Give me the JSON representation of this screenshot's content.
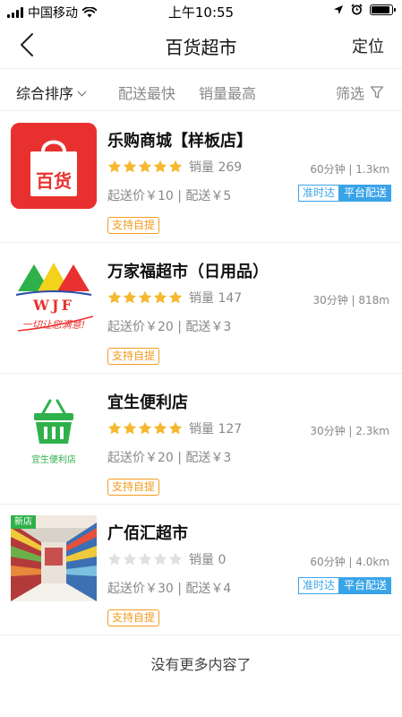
{
  "status_bar": {
    "carrier": "中国移动",
    "time": "上午10:55",
    "battery_level": 0.9
  },
  "nav": {
    "title": "百货超市",
    "right_label": "定位"
  },
  "sort_bar": {
    "items": [
      {
        "label": "综合排序",
        "active": true
      },
      {
        "label": "配送最快",
        "active": false
      },
      {
        "label": "销量最高",
        "active": false
      }
    ],
    "filter_label": "筛选"
  },
  "colors": {
    "star_on": "#f5b82e",
    "star_off": "#e0e0e0",
    "accent_blue": "#3aa4e8",
    "accent_orange": "#f29c1f"
  },
  "stores": [
    {
      "name": "乐购商城【样板店】",
      "logo": "department-store-bag-logo",
      "logo_text": "百货",
      "rating": 5,
      "sales": "销量 269",
      "meta": "60分钟 | 1.3km",
      "delivery": "起送价￥10 | 配送￥5",
      "badges": [
        "准时达",
        "平台配送"
      ],
      "pickup": "支持自提"
    },
    {
      "name": "万家福超市（日用品）",
      "logo": "wjf-logo",
      "logo_text": "WJF",
      "logo_slogan": "一切让您满意!",
      "rating": 5,
      "sales": "销量 147",
      "meta": "30分钟 | 818m",
      "delivery": "起送价￥20 | 配送￥3",
      "badges": [],
      "pickup": "支持自提"
    },
    {
      "name": "宜生便利店",
      "logo": "green-basket-logo",
      "logo_text": "宜生便利店",
      "rating": 5,
      "sales": "销量 127",
      "meta": "30分钟 | 2.3km",
      "delivery": "起送价￥20 | 配送￥3",
      "badges": [],
      "pickup": "支持自提"
    },
    {
      "name": "广佰汇超市",
      "logo": "supermarket-aisle-photo",
      "logo_tag": "新店",
      "rating": 0,
      "sales": "销量 0",
      "meta": "60分钟 | 4.0km",
      "delivery": "起送价￥30 | 配送￥4",
      "badges": [
        "准时达",
        "平台配送"
      ],
      "pickup": "支持自提"
    }
  ],
  "footer": "没有更多内容了"
}
